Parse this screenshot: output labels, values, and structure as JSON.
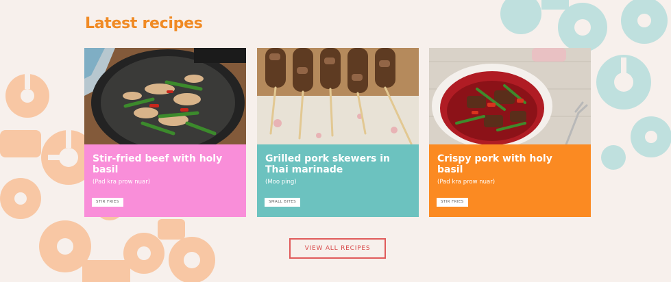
{
  "section": {
    "title": "Latest recipes"
  },
  "cards": [
    {
      "title": "Stir-fried beef with holy basil",
      "subtitle": "(Pad kra prow nuar)",
      "tag": "STIR FRIES",
      "color": "#f98ed9",
      "image": "wok-beef-dish"
    },
    {
      "title": "Grilled pork skewers in Thai marinade",
      "subtitle": "(Moo ping)",
      "tag": "SMALL BITES",
      "color": "#6cc2bf",
      "image": "pork-skewers"
    },
    {
      "title": "Crispy pork with holy basil",
      "subtitle": "(Pad kra prow nuar)",
      "tag": "STIR FRIES",
      "color": "#fb8a22",
      "image": "red-bowl-pork"
    }
  ],
  "view_all_label": "VIEW ALL RECIPES",
  "colors": {
    "title": "#f08a24",
    "background": "#f7f0ec",
    "button_border": "#e05a5a",
    "deco_orange": "#f8c7a4",
    "deco_teal": "#bfe0de"
  }
}
